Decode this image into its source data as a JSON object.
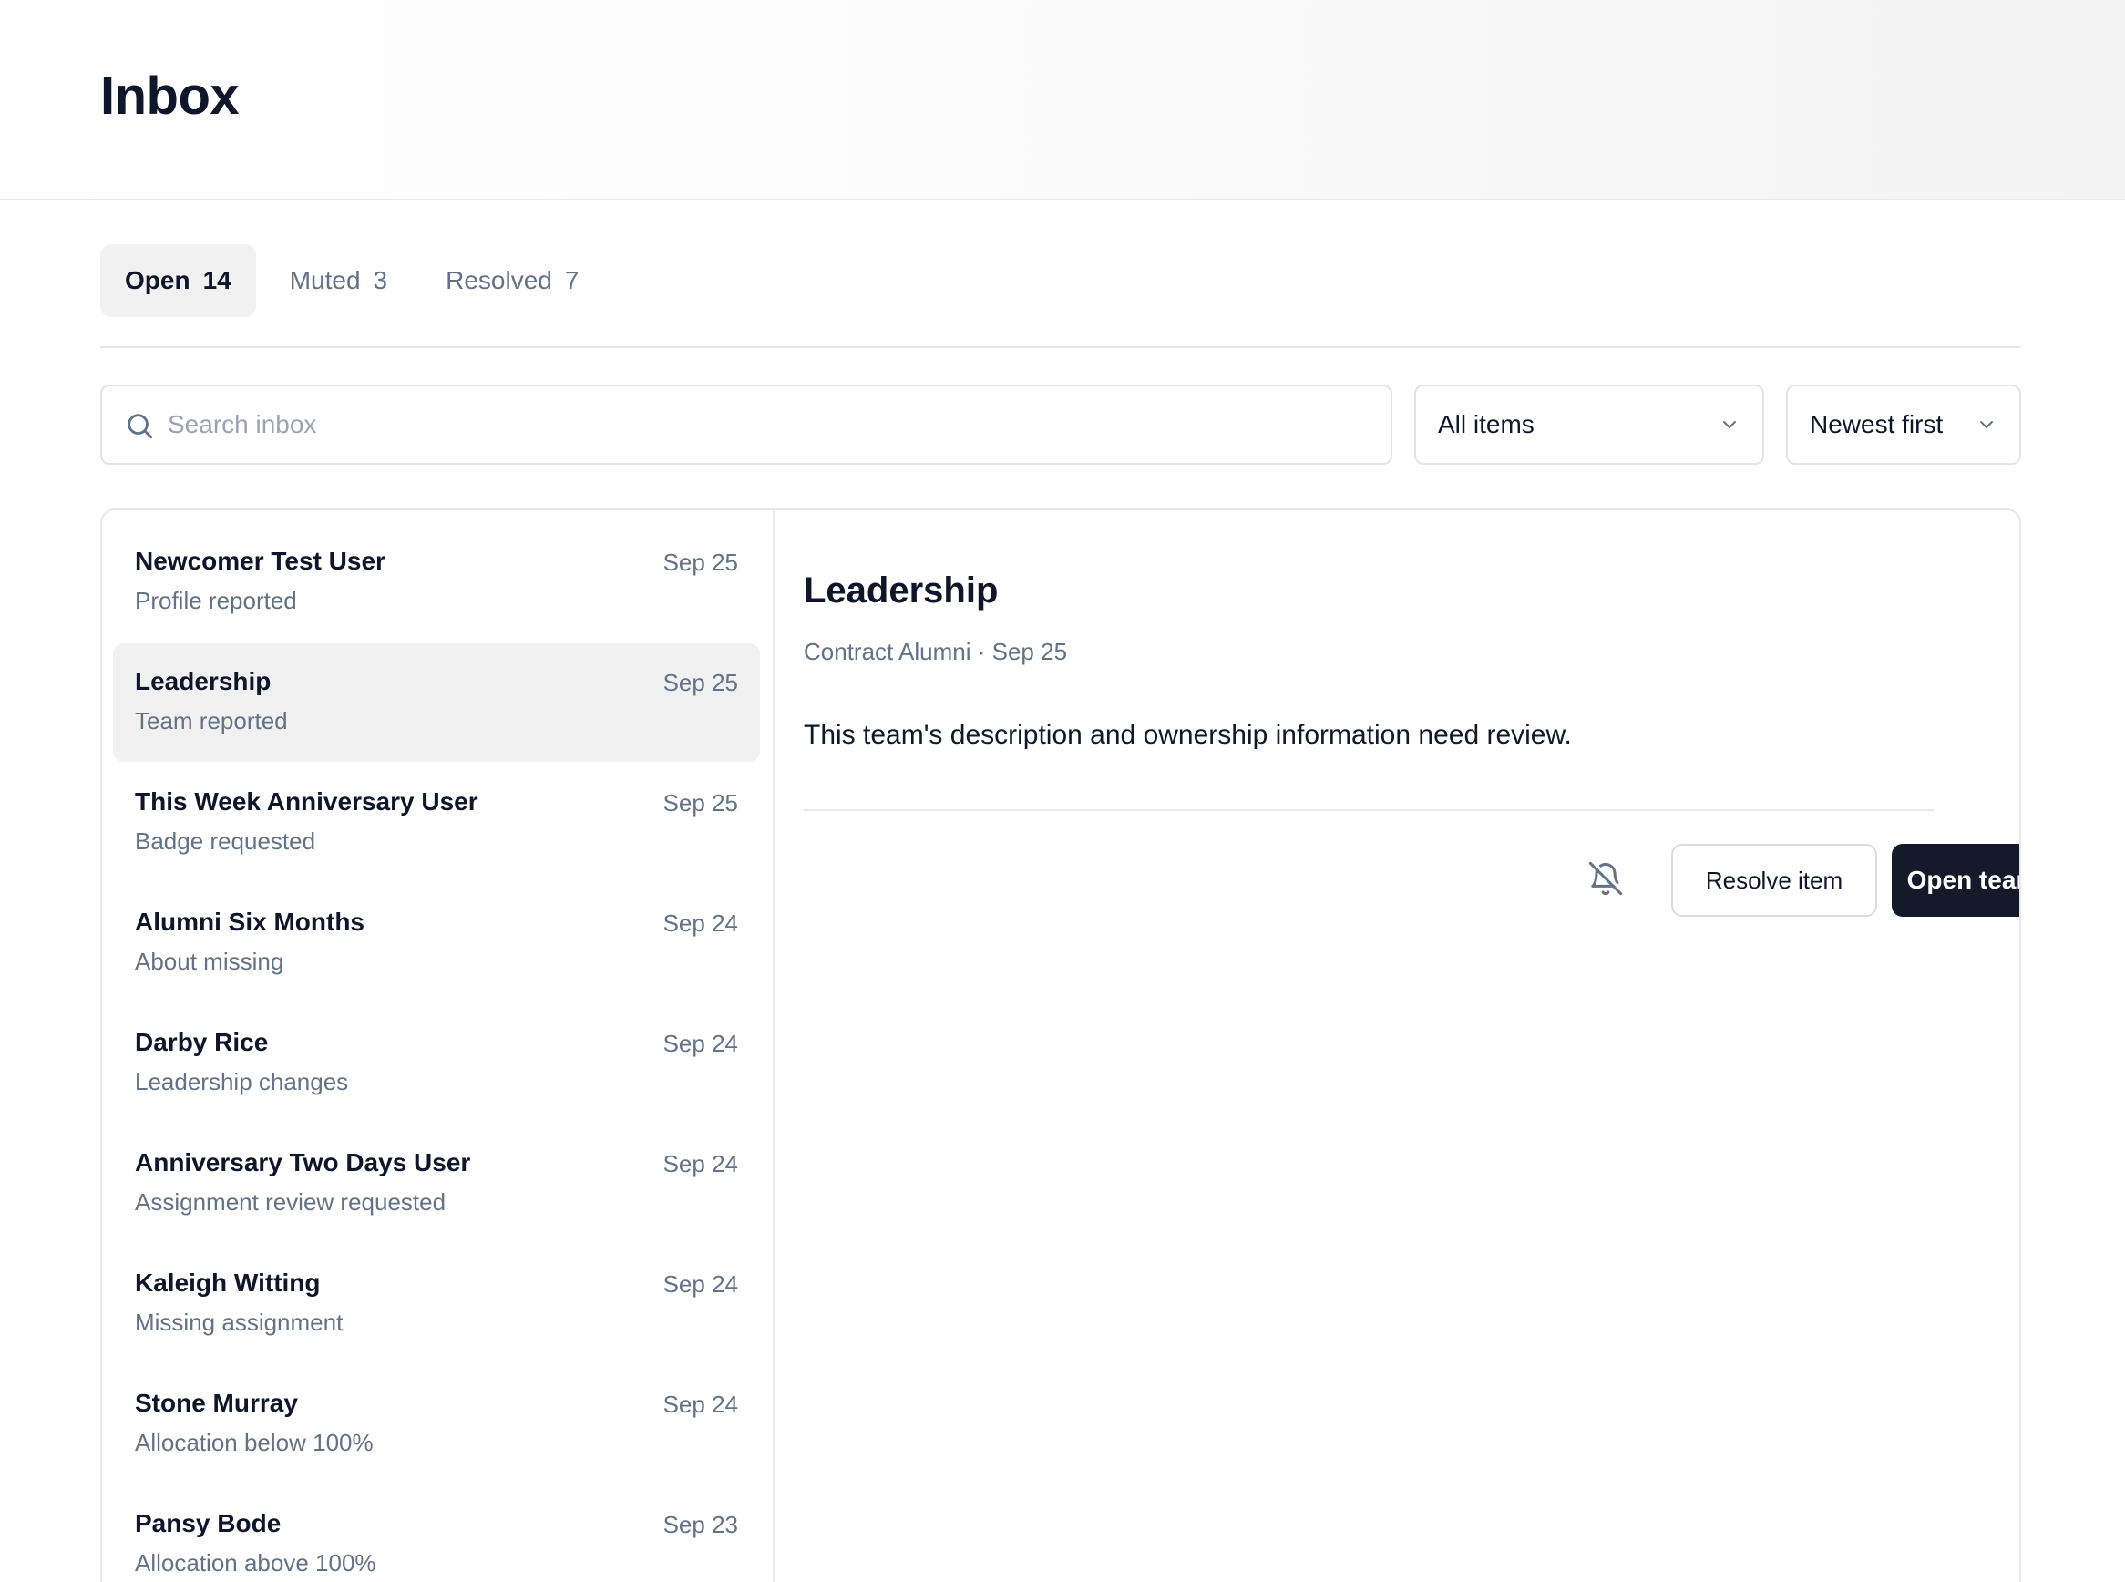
{
  "header": {
    "title": "Inbox"
  },
  "tabs": [
    {
      "label": "Open",
      "count": "14",
      "active": true
    },
    {
      "label": "Muted",
      "count": "3",
      "active": false
    },
    {
      "label": "Resolved",
      "count": "7",
      "active": false
    }
  ],
  "search": {
    "placeholder": "Search inbox",
    "value": ""
  },
  "filters": {
    "items": {
      "selected": "All items"
    },
    "sort": {
      "selected": "Newest first"
    }
  },
  "list": {
    "items": [
      {
        "name": "Newcomer Test User",
        "subtitle": "Profile reported",
        "date": "Sep 25"
      },
      {
        "name": "Leadership",
        "subtitle": "Team reported",
        "date": "Sep 25",
        "selected": true
      },
      {
        "name": "This Week Anniversary User",
        "subtitle": "Badge requested",
        "date": "Sep 25"
      },
      {
        "name": "Alumni Six Months",
        "subtitle": "About missing",
        "date": "Sep 24"
      },
      {
        "name": "Darby Rice",
        "subtitle": "Leadership changes",
        "date": "Sep 24"
      },
      {
        "name": "Anniversary Two Days User",
        "subtitle": "Assignment review requested",
        "date": "Sep 24"
      },
      {
        "name": "Kaleigh Witting",
        "subtitle": "Missing assignment",
        "date": "Sep 24"
      },
      {
        "name": "Stone Murray",
        "subtitle": "Allocation below 100%",
        "date": "Sep 24"
      },
      {
        "name": "Pansy Bode",
        "subtitle": "Allocation above 100%",
        "date": "Sep 23"
      }
    ]
  },
  "detail": {
    "title": "Leadership",
    "meta": "Contract Alumni · Sep 25",
    "body": "This team's description and ownership information need review.",
    "mute_icon": "bell-off-icon",
    "resolve_label": "Resolve item",
    "open_label": "Open team"
  },
  "colors": {
    "primary_button": "#141a29",
    "muted_text": "#647286",
    "selected_bg": "#f1f1f2"
  }
}
